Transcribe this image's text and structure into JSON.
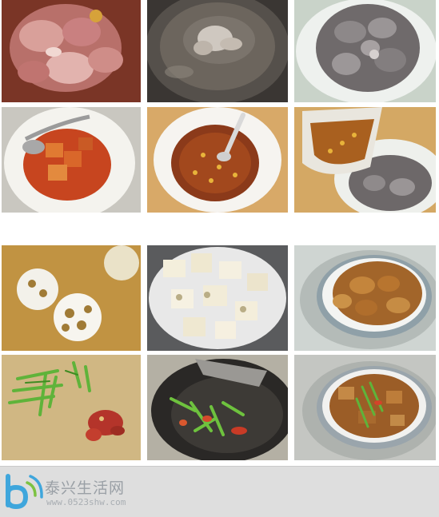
{
  "photos": [
    {
      "label": "raw-ribs"
    },
    {
      "label": "blanching-ribs"
    },
    {
      "label": "drained-ribs"
    },
    {
      "label": "fermented-tofu-sauce"
    },
    {
      "label": "mixed-bean-sauce"
    },
    {
      "label": "pour-sauce-on-ribs"
    },
    {
      "label": "lotus-root-slices"
    },
    {
      "label": "lotus-root-in-bowl"
    },
    {
      "label": "ribs-in-steamer"
    },
    {
      "label": "scallion-and-chili"
    },
    {
      "label": "stir-fry-scallion-chili"
    },
    {
      "label": "finished-dish"
    }
  ],
  "footer": {
    "brand": "泰兴生活网",
    "site": "www.0523shw.com"
  },
  "colors": {
    "footer_bg": "#dedede",
    "brand_text": "#9aa0a6",
    "logo_blue": "#3fa6dc",
    "logo_green": "#7cc242"
  }
}
